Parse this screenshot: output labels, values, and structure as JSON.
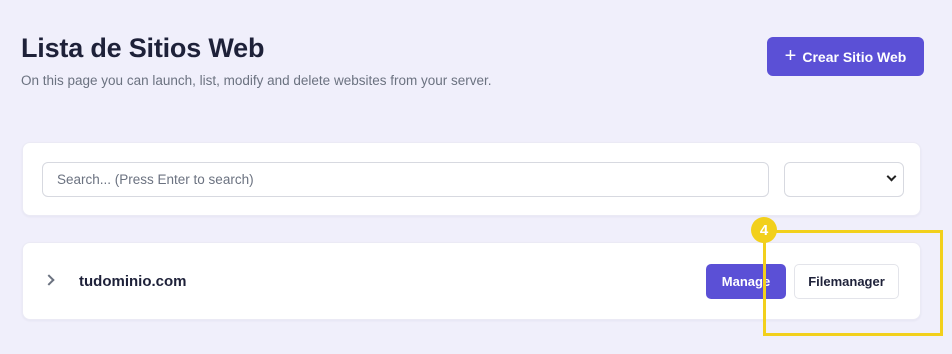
{
  "header": {
    "title": "Lista de Sitios Web",
    "subtitle": "On this page you can launch, list, modify and delete websites from your server.",
    "create_button": {
      "icon": "plus-icon",
      "label": "Crear Sitio Web"
    }
  },
  "search": {
    "placeholder": "Search... (Press Enter to search)",
    "value": "",
    "filter_selected": ""
  },
  "sites": [
    {
      "domain": "tudominio.com",
      "manage_label": "Manage",
      "filemanager_label": "Filemanager"
    }
  ],
  "annotation": {
    "badge_number": "4",
    "color": "#f2d01c"
  },
  "colors": {
    "accent": "#5b50d6",
    "background": "#f0effb"
  }
}
